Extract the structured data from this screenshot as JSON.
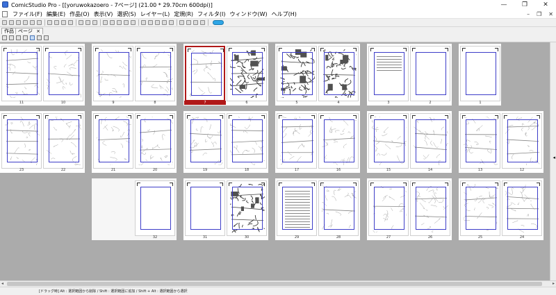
{
  "window": {
    "app_name": "ComicStudio Pro",
    "title": "ComicStudio Pro - [[yoruwokazoero - 7ページ] (21.00 * 29.70cm 600dpi)]",
    "controls": {
      "minimize": "—",
      "maximize": "❐",
      "close": "✕"
    }
  },
  "menubar": {
    "items": [
      "ファイル(F)",
      "編集(E)",
      "作品(O)",
      "表示(V)",
      "選択(S)",
      "レイヤー(L)",
      "定規(R)",
      "フィルタ(I)",
      "ウィンドウ(W)",
      "ヘルプ(H)"
    ],
    "mdi_controls": {
      "minimize": "–",
      "restore": "❐",
      "close": "✕"
    }
  },
  "toolbar": {
    "button_count": 27,
    "accent": "#2fa6e6"
  },
  "tabs": [
    {
      "label": "作品",
      "active": true
    },
    {
      "label": "ページ",
      "active": false,
      "close": "×"
    }
  ],
  "page_rows": [
    [
      {
        "pages": [
          "11",
          "10"
        ],
        "selected": null
      },
      {
        "pages": [
          "9",
          "8"
        ],
        "selected": null
      },
      {
        "pages": [
          "7",
          "6"
        ],
        "selected": "7"
      },
      {
        "pages": [
          "5",
          "4"
        ],
        "selected": null
      },
      {
        "pages": [
          "3",
          "2"
        ],
        "selected": null
      },
      {
        "pages": [
          "1"
        ],
        "selected": null
      }
    ],
    [
      {
        "pages": [
          "23",
          "22"
        ],
        "selected": null
      },
      {
        "pages": [
          "21",
          "20"
        ],
        "selected": null
      },
      {
        "pages": [
          "19",
          "18"
        ],
        "selected": null
      },
      {
        "pages": [
          "17",
          "16"
        ],
        "selected": null
      },
      {
        "pages": [
          "15",
          "14"
        ],
        "selected": null
      },
      {
        "pages": [
          "13",
          "12"
        ],
        "selected": null
      }
    ],
    [
      {
        "pages": [
          "32"
        ],
        "selected": null
      },
      {
        "pages": [
          "31",
          "30"
        ],
        "selected": null
      },
      {
        "pages": [
          "29",
          "28"
        ],
        "selected": null
      },
      {
        "pages": [
          "27",
          "26"
        ],
        "selected": null
      },
      {
        "pages": [
          "25",
          "24"
        ],
        "selected": null
      }
    ]
  ],
  "page_content": {
    "1": "blank",
    "2": "blank",
    "3": "title",
    "31": "blank",
    "32": "blank",
    "29": "text",
    "6": "dense",
    "4": "dense",
    "30": "dense",
    "5": "dense"
  },
  "status": {
    "text": "[ドラッグ時] Alt : 選択範囲から削除 / Shift : 選択範囲に追加 / Shift + Alt : 選択範囲から選択"
  },
  "colors": {
    "canvas_bg": "#ababab",
    "selection": "#b01818",
    "frame": "#3c3cc8"
  }
}
